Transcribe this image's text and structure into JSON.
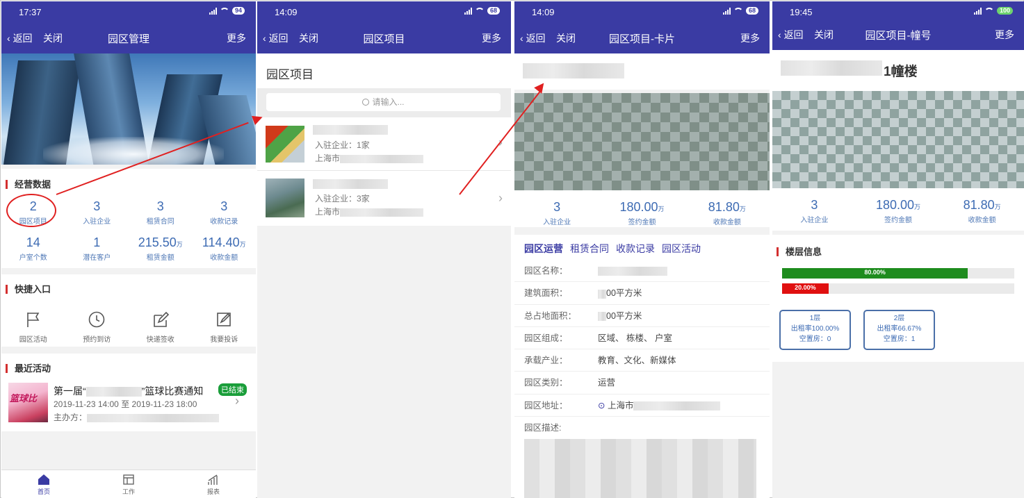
{
  "screen1": {
    "time": "17:37",
    "battery": "94",
    "nav": {
      "back": "返回",
      "close": "关闭",
      "title": "园区管理",
      "more": "更多"
    },
    "ops_title": "经营数据",
    "stats": [
      {
        "num": "2",
        "unit": "",
        "label": "园区项目"
      },
      {
        "num": "3",
        "unit": "",
        "label": "入驻企业"
      },
      {
        "num": "3",
        "unit": "",
        "label": "租赁合同"
      },
      {
        "num": "3",
        "unit": "",
        "label": "收款记录"
      },
      {
        "num": "14",
        "unit": "",
        "label": "户室个数"
      },
      {
        "num": "1",
        "unit": "",
        "label": "潜在客户"
      },
      {
        "num": "215.50",
        "unit": "万",
        "label": "租赁金额"
      },
      {
        "num": "114.40",
        "unit": "万",
        "label": "收款金额"
      }
    ],
    "quick_title": "快捷入口",
    "quick": [
      {
        "label": "园区活动",
        "icon": "flag-icon"
      },
      {
        "label": "预约到访",
        "icon": "clock-icon"
      },
      {
        "label": "快递签收",
        "icon": "edit-icon"
      },
      {
        "label": "我要投诉",
        "icon": "complaint-icon"
      }
    ],
    "recent_title": "最近活动",
    "activity": {
      "title_prefix": "第一届“",
      "title_suffix": "”篮球比赛通知",
      "badge": "已结束",
      "time": "2019-11-23 14:00 至 2019-11-23 18:00",
      "organizer": "主办方：",
      "thumb_text": "篮球比"
    },
    "tabs": [
      {
        "label": "首页",
        "icon": "home-icon"
      },
      {
        "label": "工作",
        "icon": "work-icon"
      },
      {
        "label": "报表",
        "icon": "report-icon"
      }
    ]
  },
  "screen2": {
    "time": "14:09",
    "battery": "68",
    "nav": {
      "back": "返回",
      "close": "关闭",
      "title": "园区项目",
      "more": "更多"
    },
    "heading": "园区项目",
    "search_placeholder": "请输入...",
    "items": [
      {
        "companies": "入驻企业：1家",
        "address": "上海市"
      },
      {
        "companies": "入驻企业：3家",
        "address": "上海市"
      }
    ]
  },
  "screen3": {
    "time": "14:09",
    "battery": "68",
    "nav": {
      "back": "返回",
      "close": "关闭",
      "title": "园区项目-卡片",
      "more": "更多"
    },
    "stats": [
      {
        "num": "3",
        "unit": "",
        "label": "入驻企业"
      },
      {
        "num": "180.00",
        "unit": "万",
        "label": "签约金额"
      },
      {
        "num": "81.80",
        "unit": "万",
        "label": "收款金额"
      }
    ],
    "tabs": [
      "园区运营",
      "租赁合同",
      "收款记录",
      "园区活动"
    ],
    "fields": [
      {
        "label": "园区名称：",
        "pre": "",
        "value": ""
      },
      {
        "label": "建筑面积：",
        "pre": "",
        "value": "00平方米"
      },
      {
        "label": "总占地面积：",
        "pre": "",
        "value": "00平方米"
      },
      {
        "label": "园区组成：",
        "pre": "",
        "value": "区域、  栋楼、   户室"
      },
      {
        "label": "承载产业：",
        "pre": "",
        "value": "教育、文化、新媒体"
      },
      {
        "label": "园区类别：",
        "pre": "",
        "value": "运营"
      },
      {
        "label": "园区地址：",
        "pre": "",
        "value": "上海市"
      },
      {
        "label": "园区描述:",
        "pre": "",
        "value": ""
      }
    ]
  },
  "screen4": {
    "time": "19:45",
    "battery": "100",
    "nav": {
      "back": "返回",
      "close": "关闭",
      "title": "园区项目-幢号",
      "more": "更多"
    },
    "building": "1幢楼",
    "stats": [
      {
        "num": "3",
        "unit": "",
        "label": "入驻企业"
      },
      {
        "num": "180.00",
        "unit": "万",
        "label": "签约金额"
      },
      {
        "num": "81.80",
        "unit": "万",
        "label": "收款金额"
      }
    ],
    "floor_title": "楼层信息",
    "bars": [
      {
        "label": "80.00%",
        "value": 0.8,
        "color": "#1e8c1e"
      },
      {
        "label": "20.00%",
        "value": 0.2,
        "color": "#e01010"
      }
    ],
    "floors": [
      {
        "name": "1层",
        "rate": "出租率100.00%",
        "vacant": "空置房：0"
      },
      {
        "name": "2层",
        "rate": "出租率66.67%",
        "vacant": "空置房：1"
      }
    ]
  },
  "colors": {
    "primary": "#3a3ba3",
    "accent": "#d32f2f",
    "stat_blue": "#3d6bb3",
    "badge_green": "#1a9e3a"
  }
}
